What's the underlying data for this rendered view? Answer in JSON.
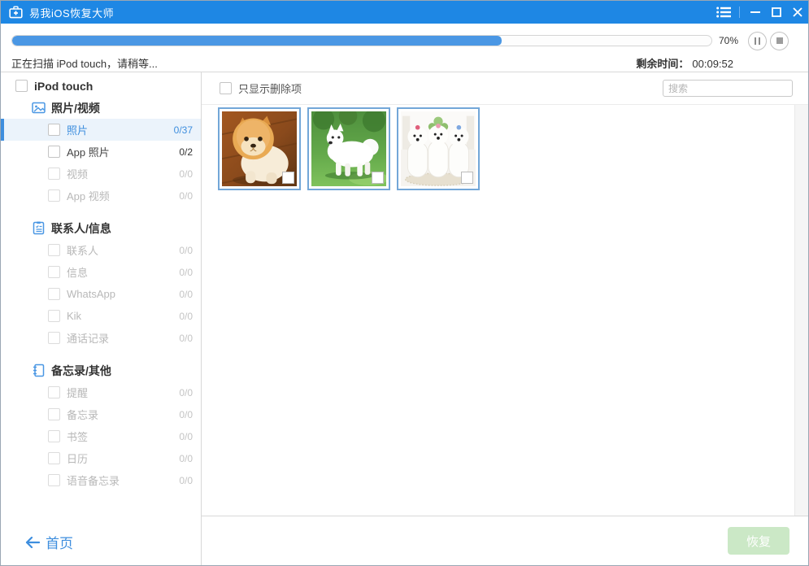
{
  "titlebar": {
    "app_title": "易我iOS恢复大师"
  },
  "scan": {
    "progress_percent": 70,
    "progress_label": "70%",
    "status_text": "正在扫描 iPod touch，请稍等...",
    "time_label": "剩余时间：",
    "time_value": "00:09:52"
  },
  "sidebar": {
    "device_label": "iPod touch",
    "sections": [
      {
        "label": "照片/视频",
        "icon": "photos-icon",
        "items": [
          {
            "label": "照片",
            "count": "0/37",
            "state": "selected"
          },
          {
            "label": "App 照片",
            "count": "0/2",
            "state": "enabled"
          },
          {
            "label": "视频",
            "count": "0/0",
            "state": "disabled"
          },
          {
            "label": "App 视频",
            "count": "0/0",
            "state": "disabled"
          }
        ]
      },
      {
        "label": "联系人/信息",
        "icon": "contacts-icon",
        "items": [
          {
            "label": "联系人",
            "count": "0/0",
            "state": "disabled"
          },
          {
            "label": "信息",
            "count": "0/0",
            "state": "disabled"
          },
          {
            "label": "WhatsApp",
            "count": "0/0",
            "state": "disabled"
          },
          {
            "label": "Kik",
            "count": "0/0",
            "state": "disabled"
          },
          {
            "label": "通话记录",
            "count": "0/0",
            "state": "disabled"
          }
        ]
      },
      {
        "label": "备忘录/其他",
        "icon": "notes-icon",
        "items": [
          {
            "label": "提醒",
            "count": "0/0",
            "state": "disabled"
          },
          {
            "label": "备忘录",
            "count": "0/0",
            "state": "disabled"
          },
          {
            "label": "书签",
            "count": "0/0",
            "state": "disabled"
          },
          {
            "label": "日历",
            "count": "0/0",
            "state": "disabled"
          },
          {
            "label": "语音备忘录",
            "count": "0/0",
            "state": "disabled"
          }
        ]
      }
    ],
    "home_label": "首页"
  },
  "main": {
    "filter_label": "只显示删除项",
    "search_placeholder": "搜索",
    "recover_button": "恢复",
    "thumbnails": [
      {
        "name": "pomeranian-puppy-photo"
      },
      {
        "name": "samoyed-dog-photo"
      },
      {
        "name": "maltese-dogs-photo"
      }
    ]
  },
  "colors": {
    "titlebar": "#1e87e4",
    "accent": "#3e8ede",
    "progress_fill": "#4a97e4",
    "selected_row_bg": "#ebf3fb",
    "thumbnail_border": "#73a7d8",
    "recover_button_bg": "#cbe8c6",
    "disabled_text": "#b8b8b8"
  }
}
